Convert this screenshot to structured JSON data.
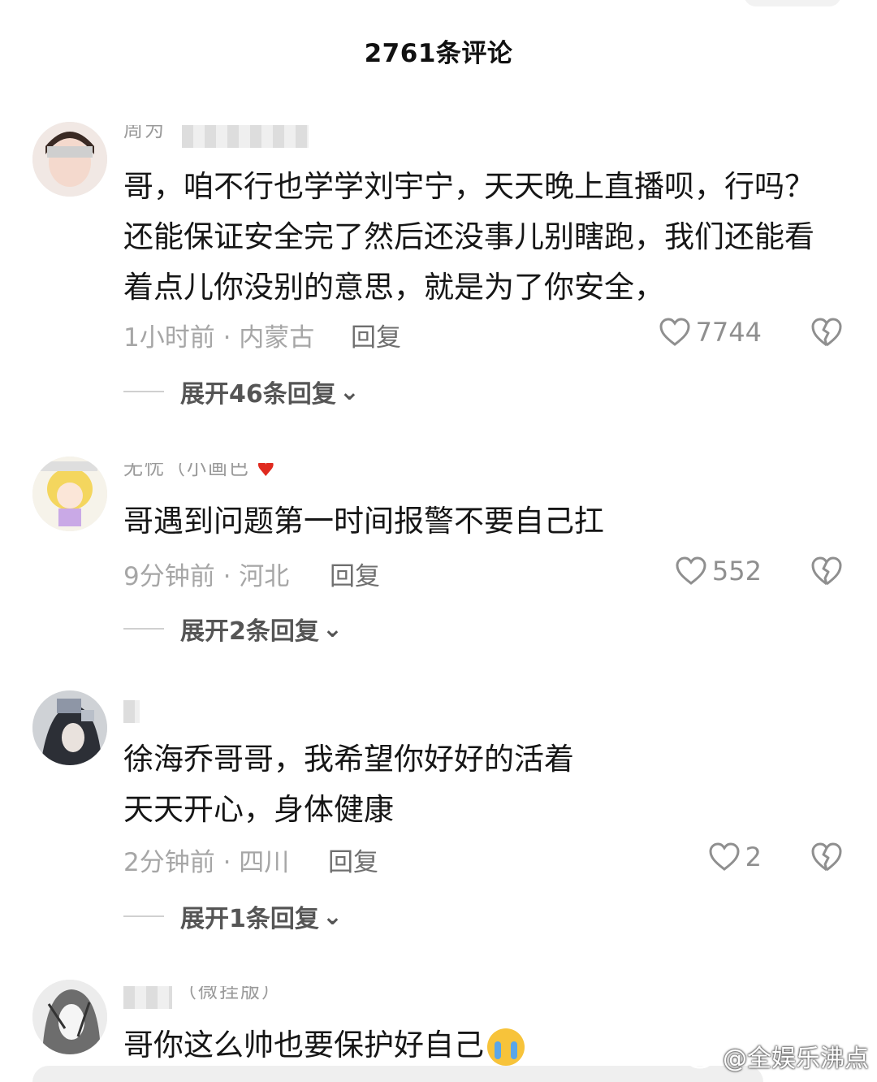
{
  "header": {
    "title": "2761条评论"
  },
  "comments": [
    {
      "username": "周为",
      "text_lines": [
        "哥，咱不行也学学刘宇宁，天天晚上直播呗，行吗？",
        "还能保证安全完了然后还没事儿别瞎跑，我们还能看",
        "着点儿你没别的意思，就是为了你安全，"
      ],
      "time_location": "1小时前 · 内蒙古",
      "reply_label": "回复",
      "likes": "7744",
      "expand_label": "展开46条回复"
    },
    {
      "username": "无忧（小画巴",
      "text_lines": [
        "哥遇到问题第一时间报警不要自己扛"
      ],
      "time_location": "9分钟前 · 河北",
      "reply_label": "回复",
      "likes": "552",
      "expand_label": "展开2条回复"
    },
    {
      "username": "",
      "text_lines": [
        "徐海乔哥哥，我希望你好好的活着",
        "天天开心，身体健康"
      ],
      "time_location": "2分钟前 · 四川",
      "reply_label": "回复",
      "likes": "2",
      "expand_label": "展开1条回复"
    },
    {
      "username": "（微挂版）",
      "text_lines": [
        "哥你这么帅也要保护好自己"
      ]
    }
  ],
  "watermark": {
    "text": "@全娱乐沸点"
  },
  "colors": {
    "meta": "#a6a6a6",
    "reply": "#6f6f6f",
    "emoji_heart": "#e02a1f"
  }
}
